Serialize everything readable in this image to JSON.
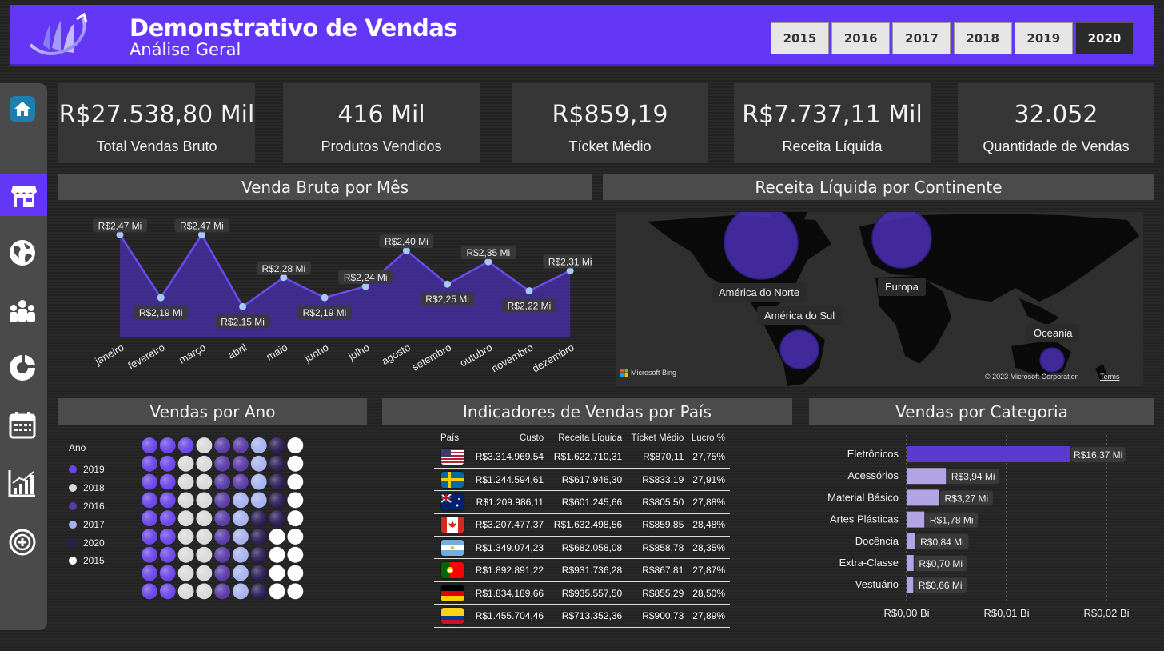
{
  "header": {
    "title": "Demonstrativo de Vendas",
    "subtitle": "Análise Geral",
    "years": [
      "2015",
      "2016",
      "2017",
      "2018",
      "2019",
      "2020"
    ],
    "selected_year": "2020"
  },
  "sidebar": {
    "items": [
      "home-icon",
      "store-icon",
      "globe-icon",
      "people-icon",
      "donut-icon",
      "calendar-icon",
      "bar-chart-icon",
      "add-icon"
    ],
    "active": "store-icon"
  },
  "kpis": [
    {
      "value": "R$27.538,80 Mil",
      "label": "Total Vendas Bruto"
    },
    {
      "value": "416 Mil",
      "label": "Produtos Vendidos"
    },
    {
      "value": "R$859,19",
      "label": "Tícket Médio"
    },
    {
      "value": "R$7.737,11 Mil",
      "label": "Receita Líquida"
    },
    {
      "value": "32.052",
      "label": "Quantidade de Vendas"
    }
  ],
  "panels": {
    "monthly": "Venda Bruta por Mês",
    "continent": "Receita Líquida por Continente",
    "yearly": "Vendas por Ano",
    "country": "Indicadores de Vendas por País",
    "category": "Vendas por Categoria"
  },
  "colors": {
    "accent": "#6436f5",
    "area": "#4a2fb0",
    "point": "#a8c8f5"
  },
  "chart_data": [
    {
      "type": "area",
      "categories": [
        "janeiro",
        "fevereiro",
        "março",
        "abril",
        "maio",
        "junho",
        "julho",
        "agosto",
        "setembro",
        "outubro",
        "novembro",
        "dezembro"
      ],
      "values": [
        2.47,
        2.19,
        2.47,
        2.15,
        2.28,
        2.19,
        2.24,
        2.4,
        2.25,
        2.35,
        2.22,
        2.31
      ],
      "labels": [
        "R$2,47 Mi",
        "R$2,19 Mi",
        "R$2,47 Mi",
        "R$2,15 Mi",
        "R$2,28 Mi",
        "R$2,19 Mi",
        "R$2,24 Mi",
        "R$2,40 Mi",
        "R$2,25 Mi",
        "R$2,35 Mi",
        "R$2,22 Mi",
        "R$2,31 Mi"
      ],
      "unit": "Mi"
    },
    {
      "type": "bubble-map",
      "points": [
        {
          "name": "América do Norte",
          "value": 1.0
        },
        {
          "name": "Europa",
          "value": 0.72
        },
        {
          "name": "América do Sul",
          "value": 0.34
        },
        {
          "name": "Oceania",
          "value": 0.13
        }
      ],
      "attribution": "Microsoft Bing",
      "copyright": "© 2023 Microsoft Corporation",
      "terms": "Terms"
    },
    {
      "type": "waffle",
      "legend_title": "Ano",
      "series": [
        {
          "name": "2019",
          "color": "#6b45e8"
        },
        {
          "name": "2018",
          "color": "#d9d9d9"
        },
        {
          "name": "2016",
          "color": "#5a3aa8"
        },
        {
          "name": "2017",
          "color": "#a7b3f0"
        },
        {
          "name": "2020",
          "color": "#2a1d55"
        },
        {
          "name": "2015",
          "color": "#ffffff"
        }
      ]
    },
    {
      "type": "table",
      "columns": [
        "País",
        "Custo",
        "Receita Líquida",
        "Tícket Médio",
        "Lucro %"
      ],
      "rows": [
        {
          "flag": "us",
          "custo": "R$3.314.969,54",
          "receita": "R$1.622.710,31",
          "ticket": "R$870,11",
          "lucro": "27,75%"
        },
        {
          "flag": "se",
          "custo": "R$1.244.594,61",
          "receita": "R$617.946,30",
          "ticket": "R$833,19",
          "lucro": "27,91%"
        },
        {
          "flag": "au",
          "custo": "R$1.209.986,11",
          "receita": "R$601.245,66",
          "ticket": "R$805,50",
          "lucro": "27,88%"
        },
        {
          "flag": "ca",
          "custo": "R$3.207.477,37",
          "receita": "R$1.632.498,56",
          "ticket": "R$859,85",
          "lucro": "28,48%"
        },
        {
          "flag": "ar",
          "custo": "R$1.349.074,23",
          "receita": "R$682.058,08",
          "ticket": "R$858,78",
          "lucro": "28,35%"
        },
        {
          "flag": "pt",
          "custo": "R$1.892.891,22",
          "receita": "R$931.736,28",
          "ticket": "R$867,81",
          "lucro": "27,87%"
        },
        {
          "flag": "de",
          "custo": "R$1.834.189,66",
          "receita": "R$935.557,50",
          "ticket": "R$855,29",
          "lucro": "28,50%"
        },
        {
          "flag": "co",
          "custo": "R$1.455.704,46",
          "receita": "R$713.352,36",
          "ticket": "R$900,73",
          "lucro": "27,89%"
        }
      ]
    },
    {
      "type": "bar",
      "orientation": "horizontal",
      "categories": [
        "Eletrônicos",
        "Acessórios",
        "Material Básico",
        "Artes Plásticas",
        "Docência",
        "Extra-Classe",
        "Vestuário"
      ],
      "values": [
        16.37,
        3.94,
        3.27,
        1.78,
        0.84,
        0.7,
        0.66
      ],
      "labels": [
        "R$16,37 Mi",
        "R$3,94 Mi",
        "R$3,27 Mi",
        "R$1,78 Mi",
        "R$0,84 Mi",
        "R$0,70 Mi",
        "R$0,66 Mi"
      ],
      "xticks": [
        "R$0,00 Bi",
        "R$0,01 Bi",
        "R$0,02 Bi"
      ],
      "xlim": [
        0,
        20
      ],
      "bar_colors": [
        "#5a3ad0",
        "#b3a4e6"
      ]
    }
  ]
}
